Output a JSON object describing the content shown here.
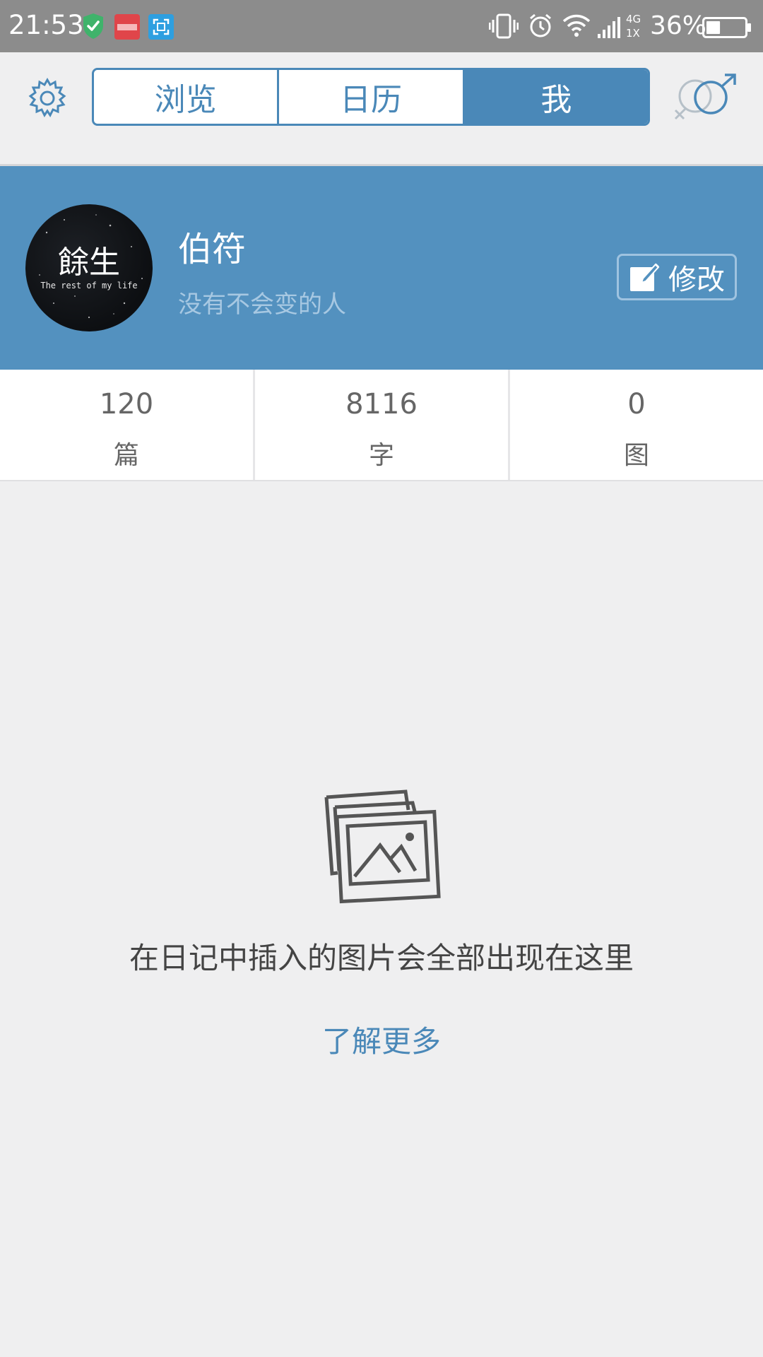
{
  "status_bar": {
    "time": "21:53",
    "network": "4G",
    "sim": "1X",
    "battery_percent": "36%",
    "battery_level": 0.36,
    "notification_icons": [
      "shield-check-icon",
      "qiku-icon",
      "screenshot-icon"
    ],
    "system_icons": [
      "vibrate-icon",
      "alarm-icon",
      "wifi-icon",
      "signal-icon",
      "battery-icon"
    ]
  },
  "nav": {
    "tabs": [
      {
        "label": "浏览",
        "active": false
      },
      {
        "label": "日历",
        "active": false
      },
      {
        "label": "我",
        "active": true
      }
    ],
    "left_icon": "settings-gear-icon",
    "right_icon": "gender-icon"
  },
  "profile": {
    "avatar_title": "餘生",
    "avatar_subtitle": "The rest of my life",
    "name": "伯符",
    "motto": "没有不会变的人",
    "edit_label": "修改"
  },
  "stats": [
    {
      "value": "120",
      "label": "篇"
    },
    {
      "value": "8116",
      "label": "字"
    },
    {
      "value": "0",
      "label": "图"
    }
  ],
  "empty_state": {
    "icon": "photos-icon",
    "message": "在日记中插入的图片会全部出现在这里",
    "link": "了解更多"
  },
  "colors": {
    "accent": "#4a88b8",
    "banner": "#5391bf",
    "status_bar": "#8c8c8c",
    "background": "#efeff0"
  }
}
